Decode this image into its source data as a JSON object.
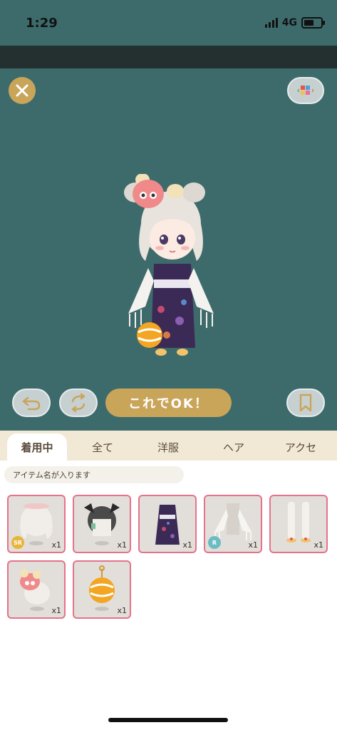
{
  "status": {
    "time": "1:29",
    "network": "4G",
    "battery_level": 0.6
  },
  "colors": {
    "stage_bg": "#3d6b6c",
    "accent_gold": "#c9a55a",
    "item_border": "#e5738a"
  },
  "actions": {
    "close_icon": "close-icon",
    "palette_icon": "color-grid-icon",
    "undo_icon": "undo-arrow-icon",
    "refresh_icon": "refresh-icon",
    "ok_label": "これでOK！",
    "bookmark_icon": "bookmark-icon"
  },
  "tabs": [
    {
      "label": "着用中",
      "active": true
    },
    {
      "label": "全て",
      "active": false
    },
    {
      "label": "洋服",
      "active": false
    },
    {
      "label": "ヘア",
      "active": false
    },
    {
      "label": "アクセ",
      "active": false
    }
  ],
  "search": {
    "placeholder": "アイテム名が入ります"
  },
  "items": [
    {
      "name": "hair-item-1",
      "qty": "x1",
      "rarity": "SR"
    },
    {
      "name": "hair-item-2",
      "qty": "x1",
      "rarity": ""
    },
    {
      "name": "yukata-item",
      "qty": "x1",
      "rarity": ""
    },
    {
      "name": "white-shawl-item",
      "qty": "x1",
      "rarity": "R"
    },
    {
      "name": "socks-sandals-item",
      "qty": "x1",
      "rarity": ""
    },
    {
      "name": "mask-accessory-item",
      "qty": "x1",
      "rarity": ""
    },
    {
      "name": "water-balloon-item",
      "qty": "x1",
      "rarity": ""
    }
  ]
}
